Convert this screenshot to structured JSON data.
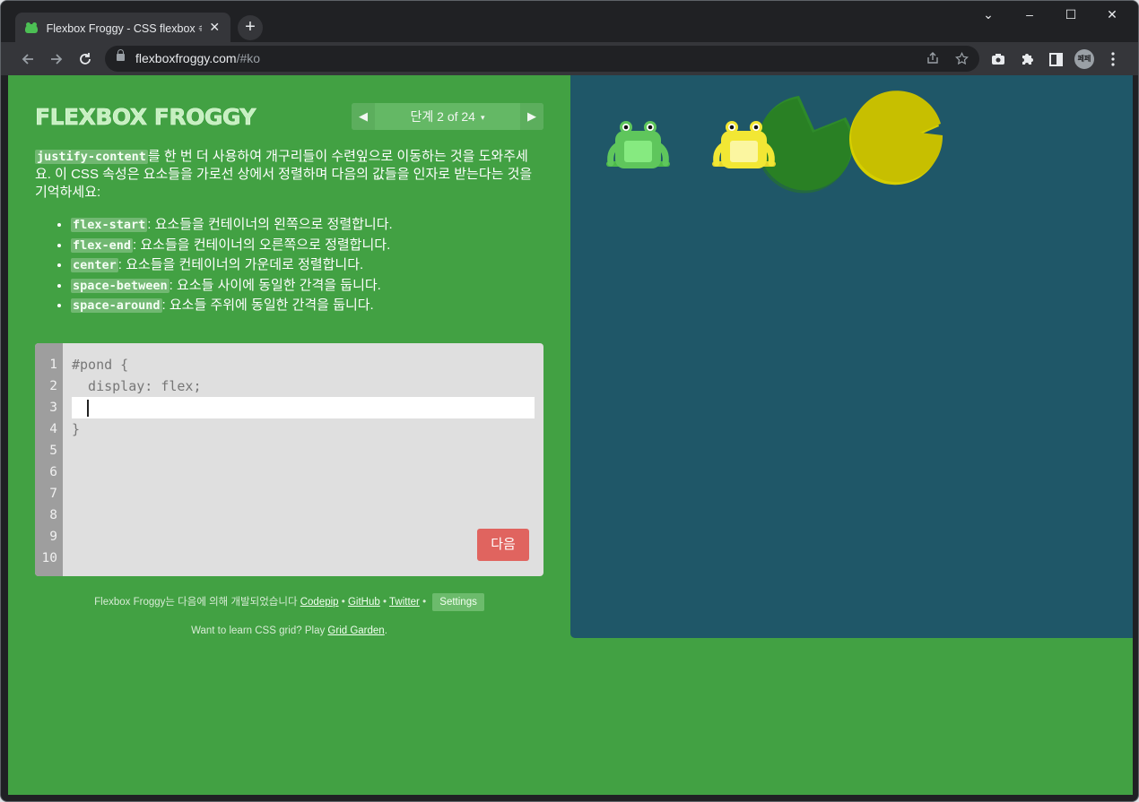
{
  "browser": {
    "tab_title": "Flexbox Froggy - CSS flexbox 속",
    "tab_close": "✕",
    "new_tab": "+",
    "url_host": "flexboxfroggy.com",
    "url_path": "/#ko",
    "profile_initials": "페페",
    "window_controls": {
      "chevron": "⌄",
      "minimize": "–",
      "maximize": "☐",
      "close": "✕"
    }
  },
  "game": {
    "logo": "FLEXBOX FROGGY",
    "level_label": "단계 2 of 24",
    "level_caret": "▾",
    "intro_code": "justify-content",
    "intro_text": "를 한 번 더 사용하여 개구리들이 수련잎으로 이동하는 것을 도와주세요. 이 CSS 속성은 요소들을 가로선 상에서 정렬하며 다음의 값들을 인자로 받는다는 것을 기억하세요:",
    "values": [
      {
        "code": "flex-start",
        "desc": ": 요소들을 컨테이너의 왼쪽으로 정렬합니다."
      },
      {
        "code": "flex-end",
        "desc": ": 요소들을 컨테이너의 오른쪽으로 정렬합니다."
      },
      {
        "code": "center",
        "desc": ": 요소들을 컨테이너의 가운데로 정렬합니다."
      },
      {
        "code": "space-between",
        "desc": ": 요소들 사이에 동일한 간격을 둡니다."
      },
      {
        "code": "space-around",
        "desc": ": 요소들 주위에 동일한 간격을 둡니다."
      }
    ],
    "line_numbers": [
      "1",
      "2",
      "3",
      "4",
      "5",
      "6",
      "7",
      "8",
      "9",
      "10"
    ],
    "code_line1": "#pond {",
    "code_line2": "  display: flex;",
    "code_input": "",
    "code_line4": "}",
    "next_button": "다음",
    "footer_prefix": "Flexbox Froggy는 다음에 의해 개발되었습니다 ",
    "footer_codepip": "Codepip",
    "footer_github": "GitHub",
    "footer_twitter": "Twitter",
    "footer_sep": " • ",
    "settings_button": "Settings",
    "grid_prefix": "Want to learn CSS grid? Play ",
    "grid_link": "Grid Garden",
    "grid_suffix": "."
  },
  "colors": {
    "page_bg": "#42a143",
    "pond_bg": "#1f5768",
    "green_frog": "#6fd36c",
    "yellow_frog": "#f3e62e",
    "green_lilypad": "#2e8a2a",
    "yellow_lilypad": "#cfc800",
    "next_button": "#e0645f"
  }
}
